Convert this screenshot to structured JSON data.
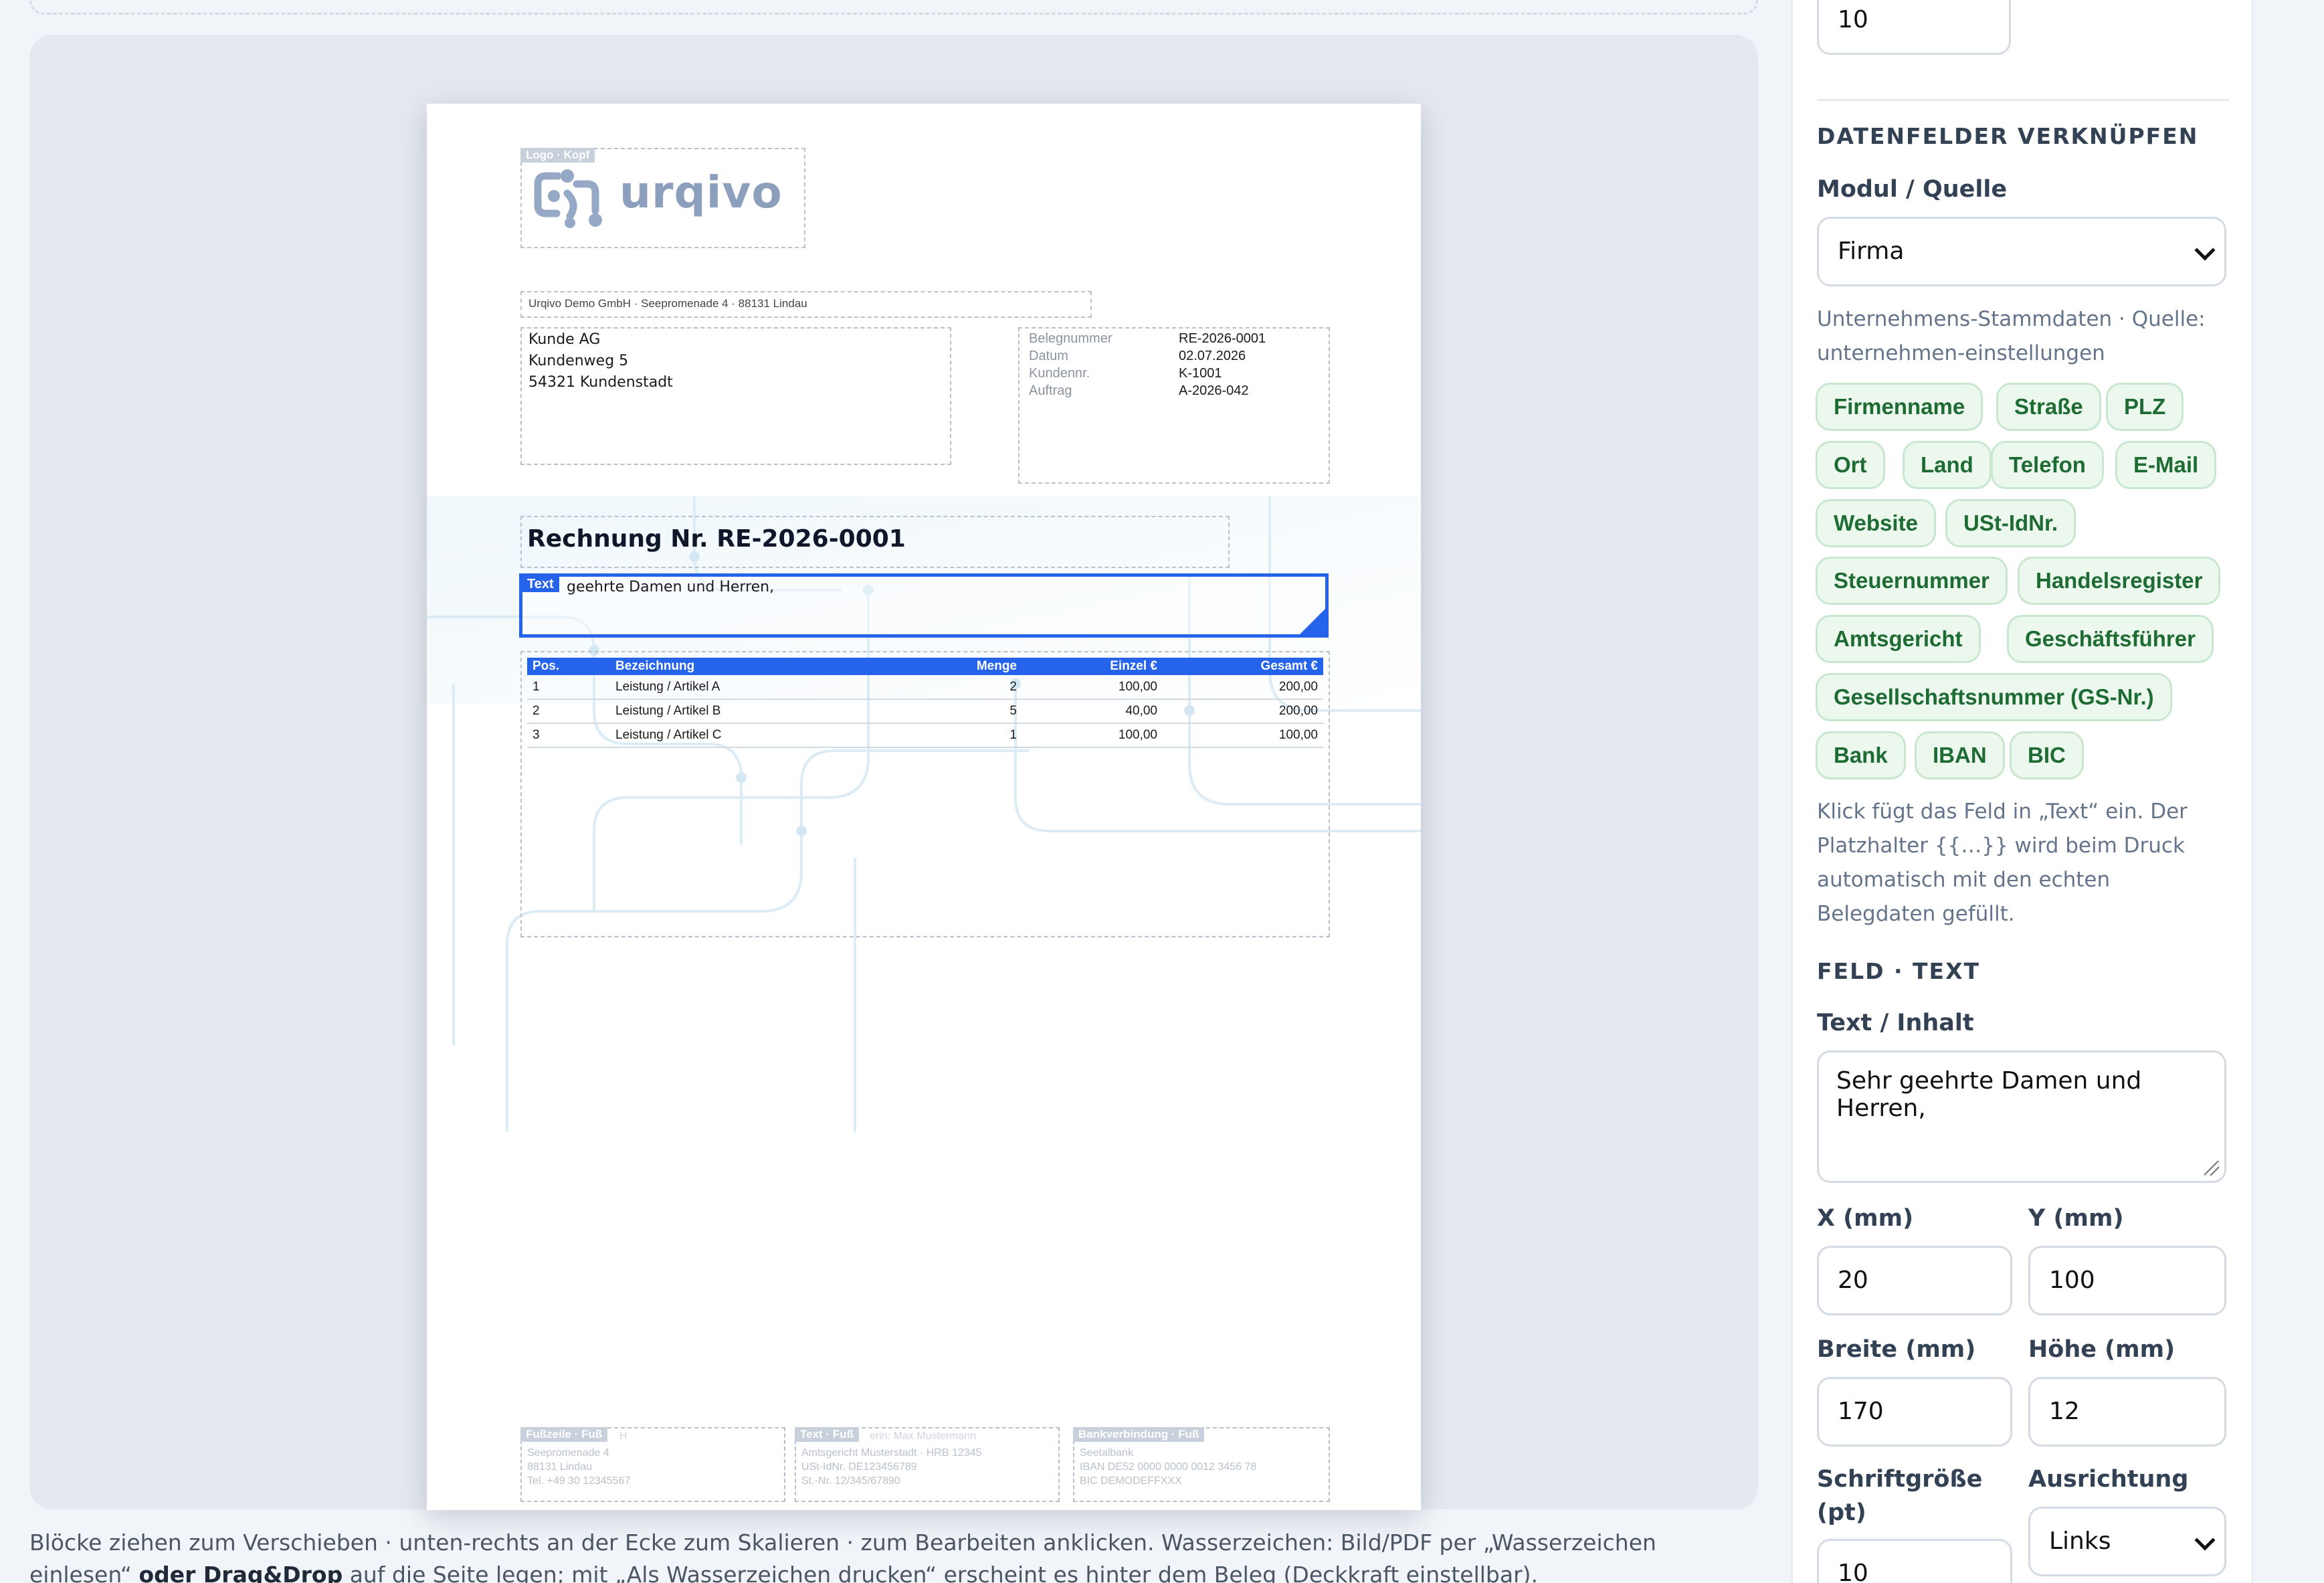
{
  "hint": {
    "part1": "Blöcke ziehen zum Verschieben · unten-rechts an der Ecke zum Skalieren · zum Bearbeiten anklicken. Wasserzeichen: Bild/PDF per „Wasserzeichen einlesen“",
    "bold": "oder Drag&Drop",
    "part2": "auf die Seite legen; mit „Als Wasserzeichen drucken“ erscheint es hinter dem Beleg (Deckkraft einstellbar)."
  },
  "document": {
    "logo_tag": "Logo · Kopf",
    "logo_text": "urqivo",
    "sender_line": "Urqivo Demo GmbH · Seepromenade 4 · 88131 Lindau",
    "address": [
      "Kunde AG",
      "Kundenweg 5",
      "54321 Kundenstadt"
    ],
    "meta": [
      {
        "k": "Belegnummer",
        "v": "RE-2026-0001"
      },
      {
        "k": "Datum",
        "v": "02.07.2026"
      },
      {
        "k": "Kundennr.",
        "v": "K-1001"
      },
      {
        "k": "Auftrag",
        "v": "A-2026-042"
      }
    ],
    "title": "Rechnung Nr. RE-2026-0001",
    "selected_tag": "Text",
    "selected_text": "geehrte Damen und Herren,",
    "table": {
      "headers": [
        "Pos.",
        "Bezeichnung",
        "Menge",
        "Einzel €",
        "Gesamt €"
      ],
      "rows": [
        [
          "1",
          "Leistung / Artikel A",
          "2",
          "100,00",
          "200,00"
        ],
        [
          "2",
          "Leistung / Artikel B",
          "5",
          "40,00",
          "200,00"
        ],
        [
          "3",
          "Leistung / Artikel C",
          "1",
          "100,00",
          "100,00"
        ]
      ]
    },
    "footer": [
      {
        "tag": "Fußzeile · Fuß",
        "title": "H",
        "lines": [
          "Seepromenade 4",
          "88131 Lindau",
          "Tel. +49 30 12345567"
        ]
      },
      {
        "tag": "Text · Fuß",
        "title": "erin: Max Mustermann",
        "lines": [
          "Amtsgericht Musterstadt · HRB 12345",
          "USt-IdNr. DE123456789",
          "St.-Nr. 12/345/67890"
        ]
      },
      {
        "tag": "Bankverbindung · Fuß",
        "title": "",
        "lines": [
          "Seetalbank",
          "IBAN DE52 0000 0000 0012 3456 78",
          "BIC DEMODEFFXXX"
        ]
      }
    ]
  },
  "panel": {
    "top_value": "10",
    "section_data": "DATENFELDER VERKNÜPFEN",
    "module_label": "Modul / Quelle",
    "module_value": "Firma",
    "source_info": "Unternehmens-Stammdaten · Quelle: unternehmen-einstellungen",
    "chips": [
      "Firmenname",
      "Straße",
      "PLZ",
      "Ort",
      "Land",
      "Telefon",
      "E-Mail",
      "Website",
      "USt-IdNr.",
      "Steuernummer",
      "Handelsregister",
      "Amtsgericht",
      "Geschäftsführer",
      "Gesellschaftsnummer (GS-Nr.)",
      "Bank",
      "IBAN",
      "BIC"
    ],
    "chip_hint": "Klick fügt das Feld in „Text“ ein. Der Platzhalter {{…}} wird beim Druck automatisch mit den echten Belegdaten gefüllt.",
    "section_field": "FELD · TEXT",
    "text_label": "Text / Inhalt",
    "text_value": "Sehr geehrte Damen und Herren,",
    "x_label": "X (mm)",
    "x_value": "20",
    "y_label": "Y (mm)",
    "y_value": "100",
    "w_label": "Breite (mm)",
    "w_value": "170",
    "h_label": "Höhe (mm)",
    "h_value": "12",
    "fs_label": "Schriftgröße (pt)",
    "fs_value": "10",
    "align_label": "Ausrichtung",
    "align_value": "Links"
  }
}
